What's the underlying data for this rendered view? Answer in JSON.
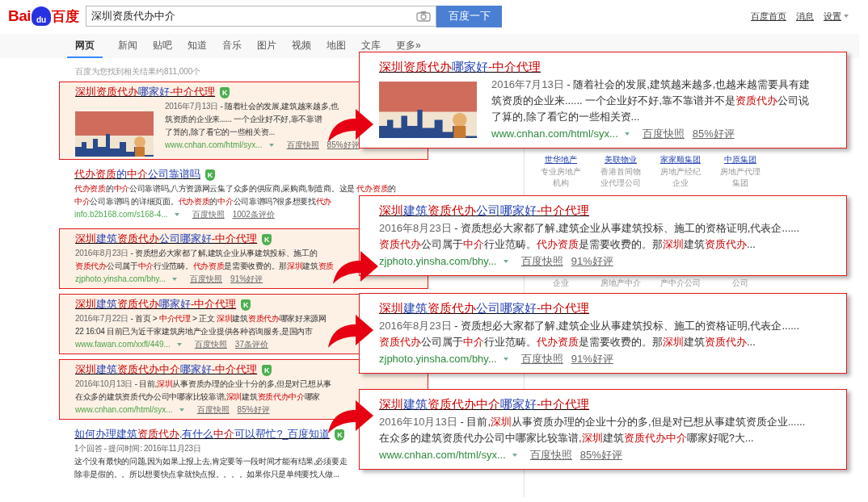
{
  "logo": {
    "left": "Bai",
    "paw": "du",
    "right": "百度"
  },
  "search": {
    "value": "深圳资质代办中介",
    "button": "百度一下"
  },
  "top_links": [
    {
      "label": "百度首页",
      "kind": "link"
    },
    {
      "label": "消息",
      "kind": "link"
    },
    {
      "label": "设置",
      "kind": "menu"
    }
  ],
  "tabs": [
    {
      "label": "网页",
      "selected": true
    },
    {
      "label": "新闻",
      "selected": false
    },
    {
      "label": "贴吧",
      "selected": false
    },
    {
      "label": "知道",
      "selected": false
    },
    {
      "label": "音乐",
      "selected": false
    },
    {
      "label": "图片",
      "selected": false
    },
    {
      "label": "视频",
      "selected": false
    },
    {
      "label": "地图",
      "selected": false
    },
    {
      "label": "文库",
      "selected": false
    },
    {
      "label": "更多»",
      "selected": false
    }
  ],
  "result_count": "百度为您找到相关结果约811,000个",
  "results": [
    {
      "highlighted": true,
      "badge": "K",
      "thumbnail": true,
      "title": [
        {
          "text": "深圳资质代办",
          "kind": "keyword"
        },
        {
          "text": "哪家好",
          "kind": "text"
        },
        {
          "text": "-中介代理",
          "kind": "keyword"
        }
      ],
      "lines": [
        [
          {
            "text": "2016年7月13日",
            "kind": "date"
          },
          {
            "text": " - 随着社会的发展,建筑越来越多,也",
            "kind": "text"
          }
        ],
        [
          {
            "text": "筑资质的企业来...... 一个企业好不好,靠不靠谱",
            "kind": "text"
          }
        ],
        [
          {
            "text": "了算的,除了看它的一些相关资...",
            "kind": "text"
          }
        ]
      ],
      "url": "www.cnhan.com/html/syx...",
      "snapshot": "百度快照",
      "rating": "85%好评"
    },
    {
      "highlighted": false,
      "badge": "K",
      "thumbnail": false,
      "title": [
        {
          "text": "代办资质",
          "kind": "keyword"
        },
        {
          "text": "的",
          "kind": "text"
        },
        {
          "text": "中介",
          "kind": "keyword"
        },
        {
          "text": "公司靠谱吗",
          "kind": "text"
        }
      ],
      "lines": [
        [
          {
            "text": "代办资质",
            "kind": "keyword"
          },
          {
            "text": "的",
            "kind": "text"
          },
          {
            "text": "中介",
            "kind": "keyword"
          },
          {
            "text": "公司靠谱吗,八方资源网云集了众多的供应商,采购商,制造商。这是 ",
            "kind": "text"
          },
          {
            "text": "代办资质",
            "kind": "keyword"
          },
          {
            "text": "的",
            "kind": "text"
          }
        ],
        [
          {
            "text": "中介",
            "kind": "keyword"
          },
          {
            "text": "公司靠谱吗 的详细页面。",
            "kind": "text"
          },
          {
            "text": "代办资质",
            "kind": "keyword"
          },
          {
            "text": "的",
            "kind": "text"
          },
          {
            "text": "中介",
            "kind": "keyword"
          },
          {
            "text": "公司靠谱吗?很多想要找",
            "kind": "text"
          },
          {
            "text": "代办",
            "kind": "keyword"
          }
        ]
      ],
      "url": "info.b2b168.com/s168-4...",
      "snapshot": "百度快照",
      "rating": "1002条评价"
    },
    {
      "highlighted": true,
      "badge": "K",
      "thumbnail": false,
      "title": [
        {
          "text": "深圳",
          "kind": "keyword"
        },
        {
          "text": "建筑",
          "kind": "text"
        },
        {
          "text": "资质代办",
          "kind": "keyword"
        },
        {
          "text": "公司哪家好",
          "kind": "text"
        },
        {
          "text": "-中介代理",
          "kind": "keyword"
        }
      ],
      "lines": [
        [
          {
            "text": "2016年8月23日",
            "kind": "date"
          },
          {
            "text": " - 资质想必大家都了解,建筑企业从事建筑投标、施工的",
            "kind": "text"
          }
        ],
        [
          {
            "text": "资质代办",
            "kind": "keyword"
          },
          {
            "text": "公司属于",
            "kind": "text"
          },
          {
            "text": "中介",
            "kind": "keyword"
          },
          {
            "text": "行业范畴。",
            "kind": "text"
          },
          {
            "text": "代办资质",
            "kind": "keyword"
          },
          {
            "text": "是需要收费的。那",
            "kind": "text"
          },
          {
            "text": "深圳",
            "kind": "keyword"
          },
          {
            "text": "建筑",
            "kind": "text"
          },
          {
            "text": "资质",
            "kind": "keyword"
          }
        ]
      ],
      "url": "zjphoto.yinsha.com/bhy...",
      "snapshot": "百度快照",
      "rating": "91%好评"
    },
    {
      "highlighted": true,
      "badge": "K",
      "thumbnail": false,
      "title": [
        {
          "text": "深圳",
          "kind": "keyword"
        },
        {
          "text": "建筑",
          "kind": "text"
        },
        {
          "text": "资质代办",
          "kind": "keyword"
        },
        {
          "text": "哪家好",
          "kind": "text"
        },
        {
          "text": "-中介代理",
          "kind": "keyword"
        }
      ],
      "lines": [
        [
          {
            "text": "2016年7月22日",
            "kind": "date"
          },
          {
            "text": " - 首页 > ",
            "kind": "text"
          },
          {
            "text": "中介代理",
            "kind": "keyword"
          },
          {
            "text": " > 正文 ",
            "kind": "text"
          },
          {
            "text": "深圳",
            "kind": "keyword"
          },
          {
            "text": "建筑",
            "kind": "text"
          },
          {
            "text": "资质代办",
            "kind": "keyword"
          },
          {
            "text": "哪家好来源网",
            "kind": "text"
          }
        ],
        [
          {
            "text": "22 16:04 目前已为近千家建筑房地产企业提供各种咨询服务,是国内市",
            "kind": "text"
          }
        ]
      ],
      "url": "www.fawan.com/xxfl/449...",
      "snapshot": "百度快照",
      "rating": "37条评价"
    },
    {
      "highlighted": true,
      "badge": "K",
      "thumbnail": false,
      "title": [
        {
          "text": "深圳",
          "kind": "keyword"
        },
        {
          "text": "建筑",
          "kind": "text"
        },
        {
          "text": "资质代办中介",
          "kind": "keyword"
        },
        {
          "text": "哪家好",
          "kind": "text"
        },
        {
          "text": "-中介代理",
          "kind": "keyword"
        }
      ],
      "lines": [
        [
          {
            "text": "2016年10月13日",
            "kind": "date"
          },
          {
            "text": " - 目前,",
            "kind": "text"
          },
          {
            "text": "深圳",
            "kind": "keyword"
          },
          {
            "text": "从事资质办理的企业十分的多,但是对已想从事",
            "kind": "text"
          }
        ],
        [
          {
            "text": "在众多的建筑资质代办公司中哪家比较靠谱,",
            "kind": "text"
          },
          {
            "text": "深圳",
            "kind": "keyword"
          },
          {
            "text": "建筑",
            "kind": "text"
          },
          {
            "text": "资质代办中介",
            "kind": "keyword"
          },
          {
            "text": "哪家",
            "kind": "text"
          }
        ]
      ],
      "url": "www.cnhan.com/html/syx...",
      "snapshot": "百度快照",
      "rating": "85%好评"
    },
    {
      "highlighted": false,
      "badge": "K",
      "thumbnail": false,
      "title": [
        {
          "text": "如何办理建筑",
          "kind": "text"
        },
        {
          "text": "资质代办",
          "kind": "keyword"
        },
        {
          "text": ",有什么",
          "kind": "text"
        },
        {
          "text": "中介",
          "kind": "keyword"
        },
        {
          "text": "可以帮忙?_百度知道",
          "kind": "text"
        }
      ],
      "lines": [
        [
          {
            "text": "1个回答 - 提问时间: 2016年11月23日",
            "kind": "date"
          }
        ],
        [
          {
            "text": "这个没有最快的问题,因为如果上报上去,肯定要等一段时间才能有结果,必须要走",
            "kind": "text"
          }
        ],
        [
          {
            "text": "除非是假的。。所以想要快点拿就快点报。。。。如果你只是单纯要找人做...",
            "kind": "text"
          }
        ]
      ]
    }
  ],
  "sidebar": {
    "cards": [
      {
        "name": "世华地产",
        "description": [
          "专业房地产",
          "机构"
        ]
      },
      {
        "name": "美联物业",
        "description": [
          "香港首间物",
          "业代理公司"
        ]
      },
      {
        "name": "家家顺集团",
        "description": [
          "房地产经纪",
          "企业"
        ]
      },
      {
        "name": "中原集团",
        "description": [
          "房地产代理",
          "集团"
        ]
      }
    ],
    "fragments": [
      "企业",
      "房地产中介",
      "产中介公司",
      "公司"
    ]
  },
  "callouts": [
    {
      "thumbnail": true,
      "title": [
        {
          "text": "深圳资质代办",
          "kind": "keyword"
        },
        {
          "text": "哪家好",
          "kind": "text"
        },
        {
          "text": "-中介代理",
          "kind": "keyword"
        }
      ],
      "lines": [
        [
          {
            "text": "2016年7月13日",
            "kind": "date"
          },
          {
            "text": " - 随着社会的发展,建筑越来越多,也越来越需要具有建",
            "kind": "text"
          }
        ],
        [
          {
            "text": "筑资质的企业来...... 一个企业好不好,靠不靠谱并不是",
            "kind": "text"
          },
          {
            "text": "资质代办",
            "kind": "keyword"
          },
          {
            "text": "公司说",
            "kind": "text"
          }
        ],
        [
          {
            "text": "了算的,除了看它的一些相关资...",
            "kind": "text"
          }
        ]
      ],
      "url": "www.cnhan.com/html/syx...",
      "snapshot": "百度快照",
      "rating": "85%好评"
    },
    {
      "thumbnail": false,
      "title": [
        {
          "text": "深圳",
          "kind": "keyword"
        },
        {
          "text": "建筑",
          "kind": "text"
        },
        {
          "text": "资质代办",
          "kind": "keyword"
        },
        {
          "text": "公司哪家好",
          "kind": "text"
        },
        {
          "text": "-中介代理",
          "kind": "keyword"
        }
      ],
      "lines": [
        [
          {
            "text": "2016年8月23日",
            "kind": "date"
          },
          {
            "text": " - 资质想必大家都了解,建筑企业从事建筑投标、施工的资格证明,代表企......",
            "kind": "text"
          }
        ],
        [
          {
            "text": "资质代办",
            "kind": "keyword"
          },
          {
            "text": "公司属于",
            "kind": "text"
          },
          {
            "text": "中介",
            "kind": "keyword"
          },
          {
            "text": "行业范畴。",
            "kind": "text"
          },
          {
            "text": "代办资质",
            "kind": "keyword"
          },
          {
            "text": "是需要收费的。那",
            "kind": "text"
          },
          {
            "text": "深圳",
            "kind": "keyword"
          },
          {
            "text": "建筑",
            "kind": "text"
          },
          {
            "text": "资质代办",
            "kind": "keyword"
          },
          {
            "text": "...",
            "kind": "text"
          }
        ]
      ],
      "url": "zjphoto.yinsha.com/bhy...",
      "snapshot": "百度快照",
      "rating": "91%好评"
    },
    {
      "thumbnail": false,
      "title": [
        {
          "text": "深圳",
          "kind": "keyword"
        },
        {
          "text": "建筑",
          "kind": "text"
        },
        {
          "text": "资质代办",
          "kind": "keyword"
        },
        {
          "text": "公司哪家好",
          "kind": "text"
        },
        {
          "text": "-中介代理",
          "kind": "keyword"
        }
      ],
      "lines": [
        [
          {
            "text": "2016年8月23日",
            "kind": "date"
          },
          {
            "text": " - 资质想必大家都了解,建筑企业从事建筑投标、施工的资格证明,代表企......",
            "kind": "text"
          }
        ],
        [
          {
            "text": "资质代办",
            "kind": "keyword"
          },
          {
            "text": "公司属于",
            "kind": "text"
          },
          {
            "text": "中介",
            "kind": "keyword"
          },
          {
            "text": "行业范畴。",
            "kind": "text"
          },
          {
            "text": "代办资质",
            "kind": "keyword"
          },
          {
            "text": "是需要收费的。那",
            "kind": "text"
          },
          {
            "text": "深圳",
            "kind": "keyword"
          },
          {
            "text": "建筑",
            "kind": "text"
          },
          {
            "text": "资质代办",
            "kind": "keyword"
          },
          {
            "text": "...",
            "kind": "text"
          }
        ]
      ],
      "url": "zjphoto.yinsha.com/bhy...",
      "snapshot": "百度快照",
      "rating": "91%好评"
    },
    {
      "thumbnail": false,
      "title": [
        {
          "text": "深圳",
          "kind": "keyword"
        },
        {
          "text": "建筑",
          "kind": "text"
        },
        {
          "text": "资质代办中介",
          "kind": "keyword"
        },
        {
          "text": "哪家好",
          "kind": "text"
        },
        {
          "text": "-中介代理",
          "kind": "keyword"
        }
      ],
      "lines": [
        [
          {
            "text": "2016年10月13日",
            "kind": "date"
          },
          {
            "text": " - 目前,",
            "kind": "text"
          },
          {
            "text": "深圳",
            "kind": "keyword"
          },
          {
            "text": "从事资质办理的企业十分的多,但是对已想从事建筑资质企业......",
            "kind": "text"
          }
        ],
        [
          {
            "text": "在众多的建筑资质代办公司中哪家比较靠谱,",
            "kind": "text"
          },
          {
            "text": "深圳",
            "kind": "keyword"
          },
          {
            "text": "建筑",
            "kind": "text"
          },
          {
            "text": "资质代办中介",
            "kind": "keyword"
          },
          {
            "text": "哪家好呢?大...",
            "kind": "text"
          }
        ]
      ],
      "url": "www.cnhan.com/html/syx...",
      "snapshot": "百度快照",
      "rating": "85%好评"
    }
  ]
}
